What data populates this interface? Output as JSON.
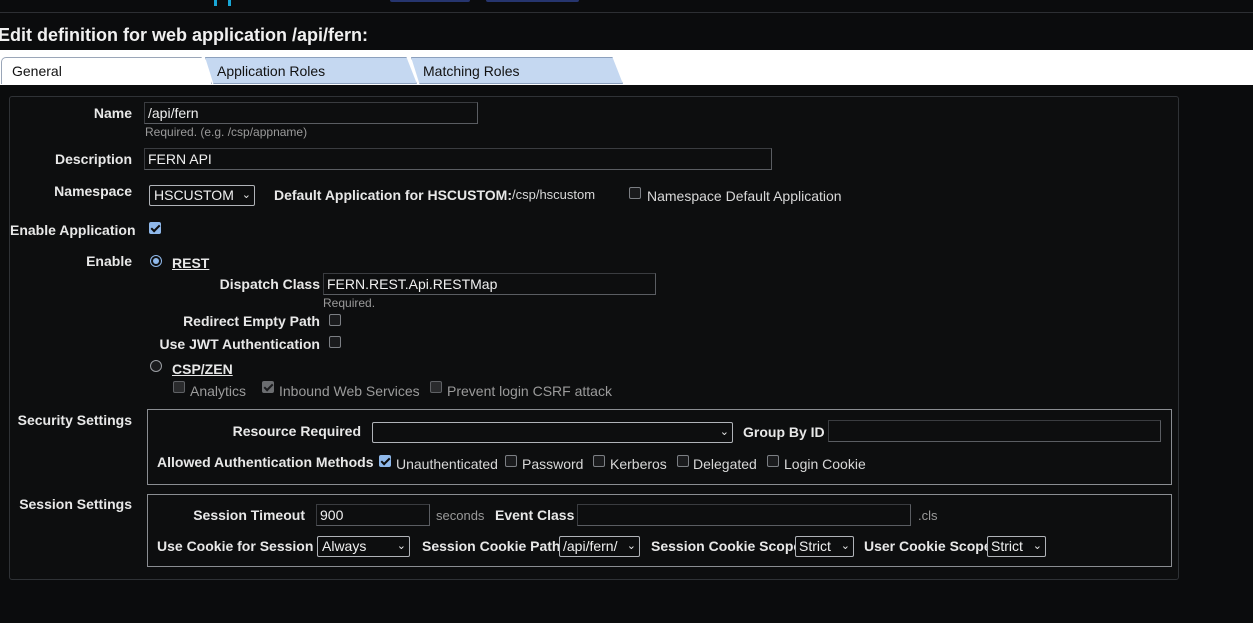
{
  "page": {
    "title": "Edit definition for web application /api/fern:"
  },
  "tabs": [
    {
      "label": "General"
    },
    {
      "label": "Application Roles"
    },
    {
      "label": "Matching Roles"
    }
  ],
  "general": {
    "name": {
      "label": "Name",
      "value": "/api/fern",
      "hint": "Required. (e.g. /csp/appname)"
    },
    "description": {
      "label": "Description",
      "value": "FERN API"
    },
    "namespace": {
      "label": "Namespace",
      "value": "HSCUSTOM",
      "default_app_label": "Default Application for HSCUSTOM:",
      "default_app_value": "/csp/hscustom",
      "ns_default_label": "Namespace Default Application"
    },
    "enable_application": {
      "label": "Enable Application",
      "checked": true
    },
    "enable": {
      "label": "Enable",
      "rest_label": "REST",
      "dispatch_class_label": "Dispatch Class",
      "dispatch_class_value": "FERN.REST.Api.RESTMap",
      "dispatch_hint": "Required.",
      "redirect_empty_path_label": "Redirect Empty Path",
      "use_jwt_label": "Use JWT Authentication",
      "csp_zen_label": "CSP/ZEN",
      "analytics_label": "Analytics",
      "inbound_ws_label": "Inbound Web Services",
      "prevent_csrf_label": "Prevent login CSRF attack"
    }
  },
  "security": {
    "label": "Security Settings",
    "resource_required_label": "Resource Required",
    "resource_required_value": "",
    "group_by_id_label": "Group By ID",
    "group_by_id_value": "",
    "auth_methods_label": "Allowed Authentication Methods",
    "methods": [
      {
        "label": "Unauthenticated",
        "checked": true
      },
      {
        "label": "Password",
        "checked": false
      },
      {
        "label": "Kerberos",
        "checked": false
      },
      {
        "label": "Delegated",
        "checked": false
      },
      {
        "label": "Login Cookie",
        "checked": false
      }
    ]
  },
  "session": {
    "label": "Session Settings",
    "timeout_label": "Session Timeout",
    "timeout_value": "900",
    "timeout_unit": "seconds",
    "event_class_label": "Event Class",
    "event_class_value": "",
    "event_class_suffix": ".cls",
    "use_cookie_label": "Use Cookie for Session",
    "use_cookie_value": "Always",
    "cookie_path_label": "Session Cookie Path",
    "cookie_path_value": "/api/fern/",
    "cookie_scope_label": "Session Cookie Scope",
    "cookie_scope_value": "Strict",
    "user_cookie_scope_label": "User Cookie Scope",
    "user_cookie_scope_value": "Strict"
  },
  "colors": {
    "background": "#0b0c0d",
    "tab_active": "#ffffff",
    "tab_inactive": "#c5d8f1",
    "accent_check": "#8fb8ea",
    "logo_accent": "#19a7d6"
  }
}
